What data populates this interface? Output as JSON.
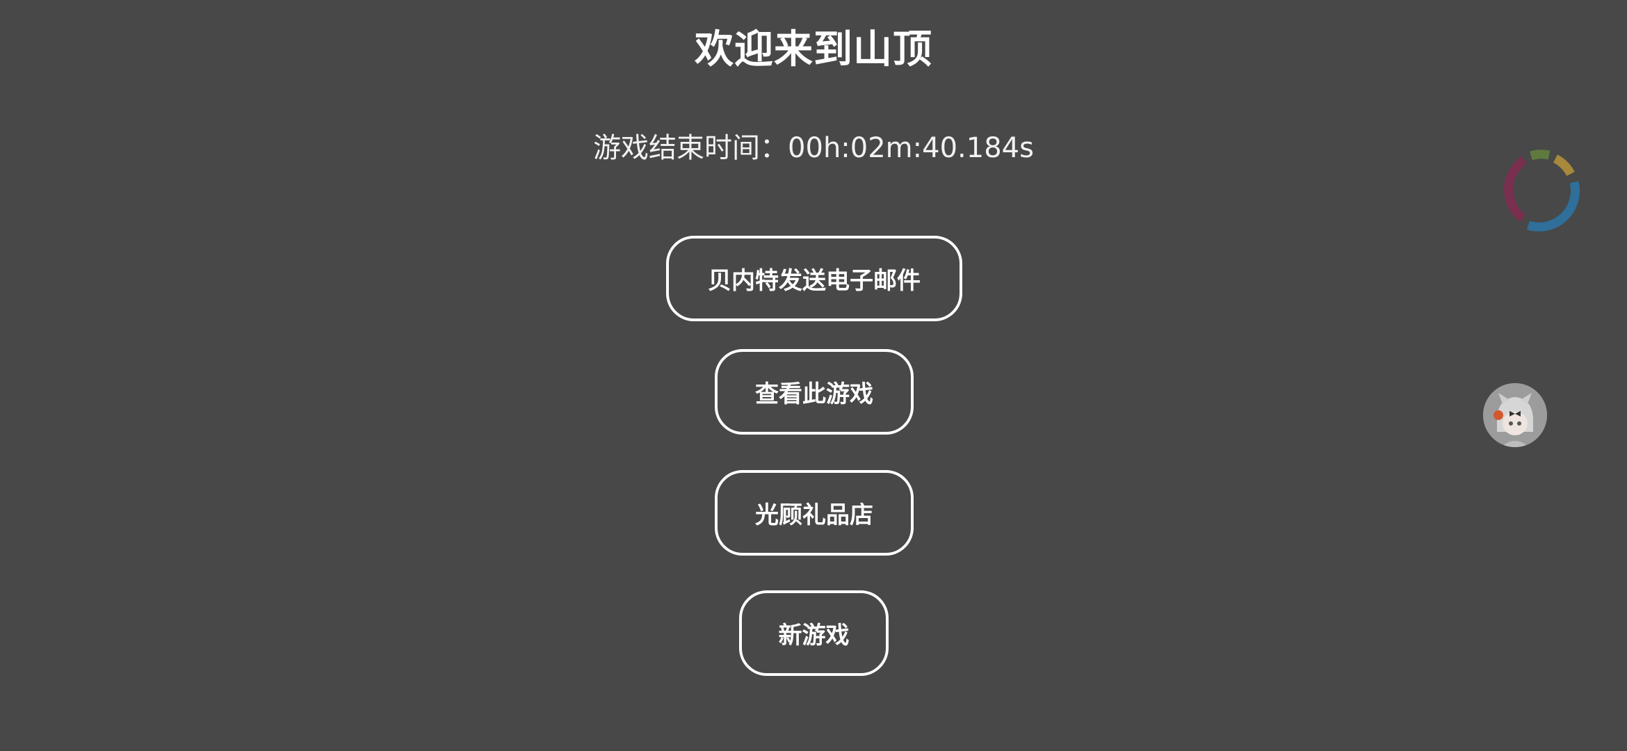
{
  "screen": {
    "title": "欢迎来到山顶",
    "timer_text": "游戏结束时间：00h:02m:40.184s"
  },
  "buttons": {
    "email_label": "贝内特发送电子邮件",
    "view_game_label": "查看此游戏",
    "gift_shop_label": "光顾礼品店",
    "new_game_label": "新游戏"
  },
  "overlay": {
    "ring_icon": "loading-ring-icon",
    "ring_colors": [
      "#7a2f4f",
      "#5f7a3e",
      "#a8883a",
      "#2f6f9a"
    ],
    "avatar_icon": "avatar-icon"
  }
}
